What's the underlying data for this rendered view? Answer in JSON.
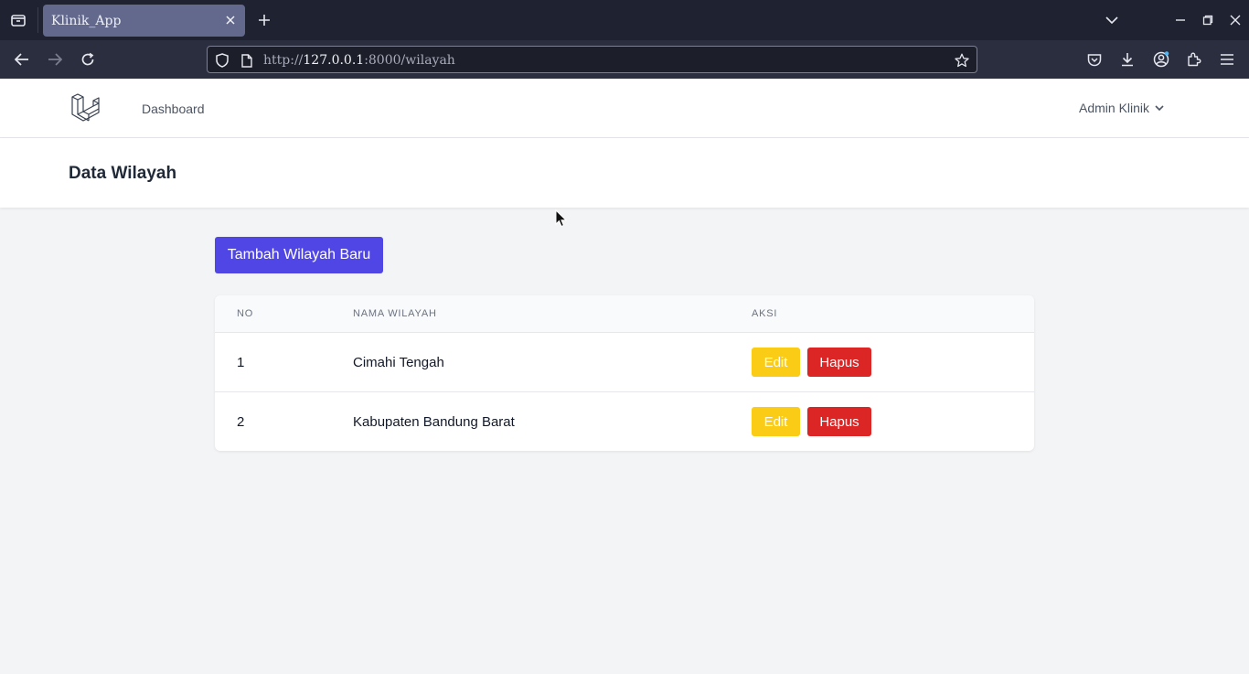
{
  "browser": {
    "tab_title": "Klinik_App",
    "url_scheme": "http://",
    "url_host": "127.0.0.1",
    "url_rest": ":8000/wilayah"
  },
  "app": {
    "nav_dashboard": "Dashboard",
    "user_menu": "Admin Klinik",
    "page_title": "Data Wilayah",
    "add_button": "Tambah Wilayah Baru",
    "table": {
      "headers": {
        "no": "NO",
        "name": "NAMA WILAYAH",
        "action": "AKSI"
      },
      "rows": [
        {
          "no": "1",
          "name": "Cimahi Tengah",
          "edit": "Edit",
          "delete": "Hapus"
        },
        {
          "no": "2",
          "name": "Kabupaten Bandung Barat",
          "edit": "Edit",
          "delete": "Hapus"
        }
      ]
    }
  },
  "colors": {
    "primary": "#4f46e5",
    "edit": "#facc15",
    "delete": "#dc2626"
  }
}
